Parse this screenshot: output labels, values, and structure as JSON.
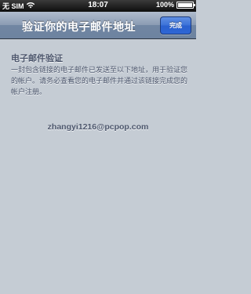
{
  "status_bar": {
    "carrier": "无 SIM",
    "time": "18:07",
    "battery": "100%",
    "battery_level": 1.0
  },
  "nav": {
    "title": "验证你的电子邮件地址",
    "done_label": "完成"
  },
  "main": {
    "section_title": "电子邮件验证",
    "description": "一封包含链接的电子邮件已发送至以下地址，用于验证您的帐户。请务必查看您的电子邮件并通过该链接完成您的帐户注册。",
    "email": "zhangyi1216@pcpop.com"
  },
  "icons": {
    "signal": "signal-bars-icon",
    "wifi": "wifi-icon",
    "battery": "battery-icon"
  },
  "colors": {
    "background": "#c5ccd4",
    "nav_bar": "#7f92ad",
    "done_button": "#3b71d8",
    "text": "#4c566c"
  }
}
